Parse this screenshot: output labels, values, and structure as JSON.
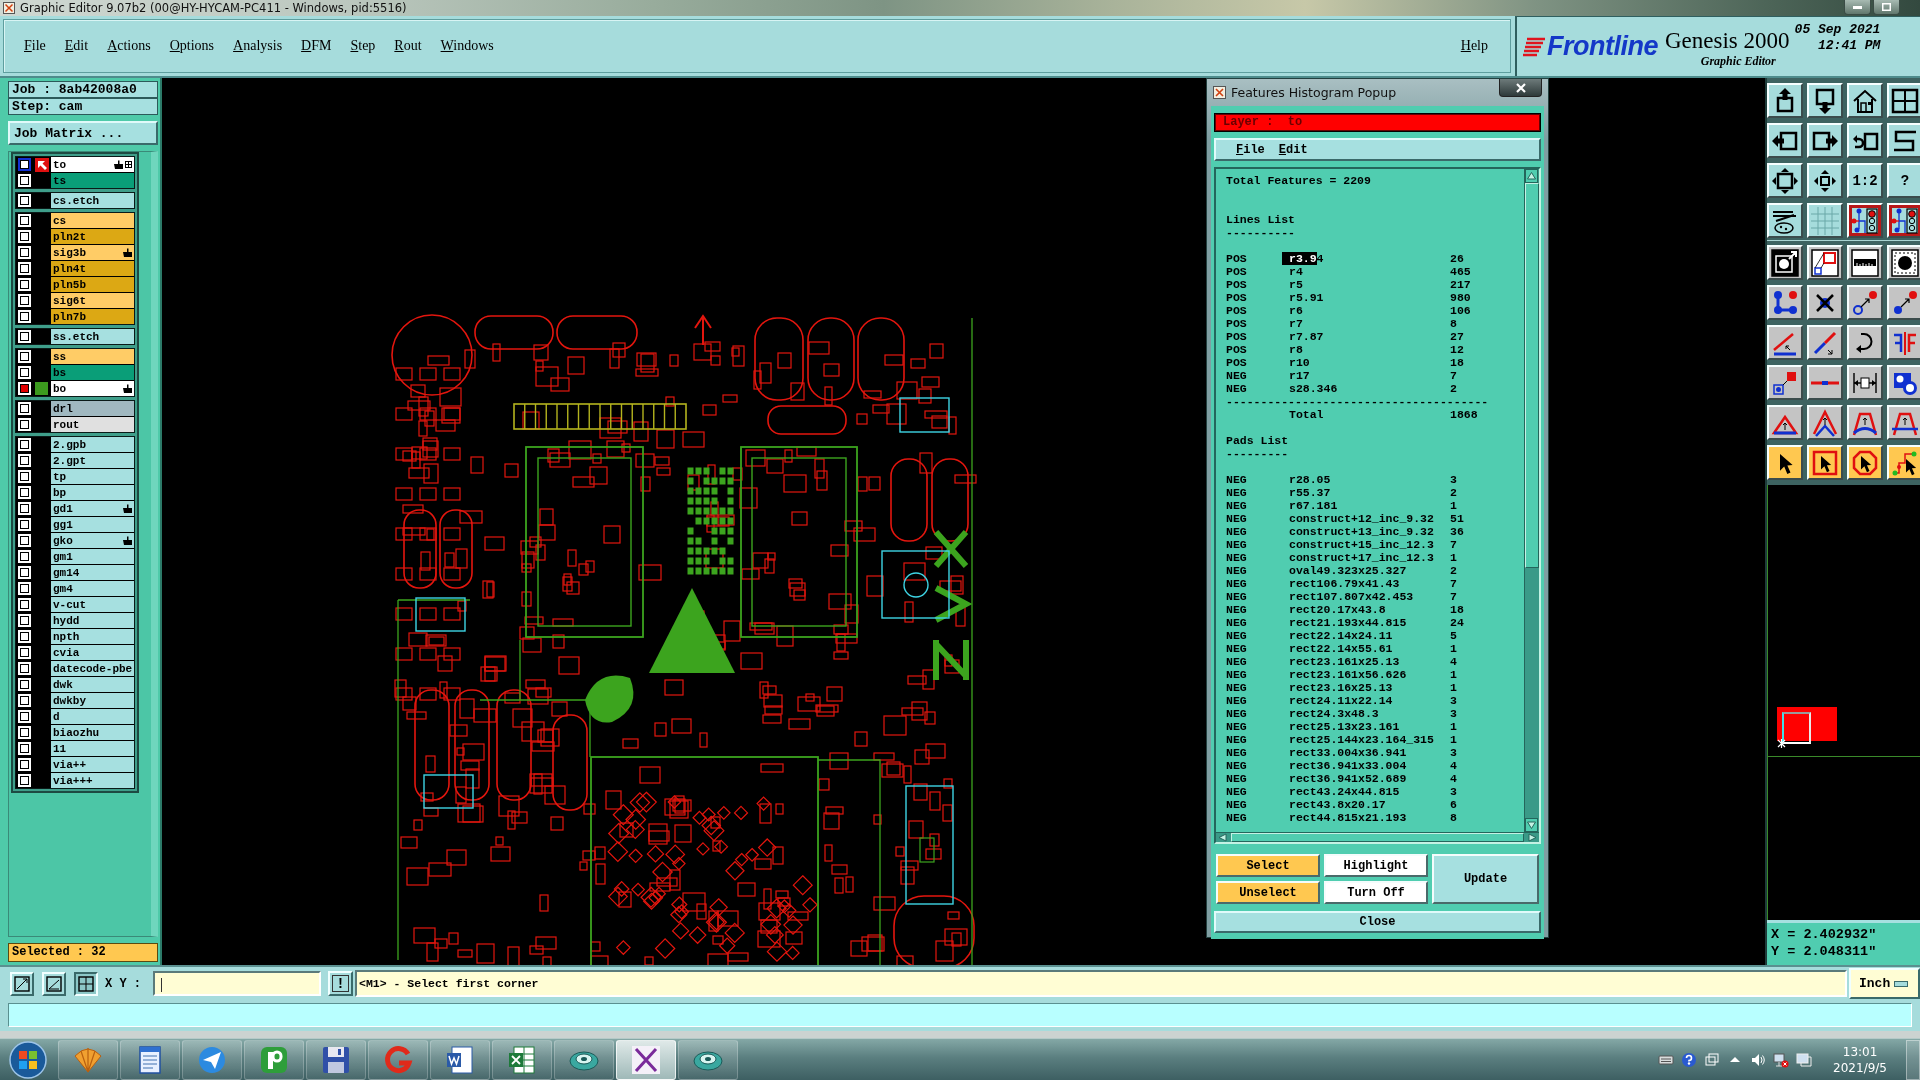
{
  "window": {
    "title": "Graphic Editor 9.07b2 (00@HY-HYCAM-PC411 - Windows, pid:5516)"
  },
  "menu": [
    {
      "label": "File"
    },
    {
      "label": "Edit"
    },
    {
      "label": "Actions"
    },
    {
      "label": "Options"
    },
    {
      "label": "Analysis"
    },
    {
      "label": "DFM"
    },
    {
      "label": "Step"
    },
    {
      "label": "Rout"
    },
    {
      "label": "Windows"
    }
  ],
  "help_menu": {
    "label": "Help"
  },
  "brand": {
    "logo": "Frontline",
    "product": "Genesis 2000",
    "subtitle": "Graphic Editor",
    "date": "05 Sep 2021",
    "time": "12:41 PM"
  },
  "job": {
    "job": "Job : 8ab42008a0",
    "step": "Step: cam",
    "matrix_button": "Job Matrix ..."
  },
  "layer_groups": [
    {
      "layers": [
        {
          "name": "to",
          "color": "#ffffff",
          "work": true,
          "affected": false,
          "displayed": false,
          "flagged": true
        },
        {
          "name": "ts",
          "color": "#0a9e78",
          "work": false,
          "affected": false,
          "displayed": false,
          "flagged": false
        }
      ]
    },
    {
      "layers": [
        {
          "name": "cs.etch",
          "color": "#a6e0e0",
          "work": false,
          "affected": false,
          "displayed": false,
          "flagged": false
        }
      ]
    },
    {
      "layers": [
        {
          "name": "cs",
          "color": "#ffcc66",
          "work": false,
          "affected": false,
          "displayed": false,
          "flagged": false
        },
        {
          "name": "pln2t",
          "color": "#dca814",
          "work": false,
          "affected": false,
          "displayed": false,
          "flagged": false
        },
        {
          "name": "sig3b",
          "color": "#ffcc66",
          "work": false,
          "affected": false,
          "displayed": false,
          "flagged": true
        },
        {
          "name": "pln4t",
          "color": "#dca814",
          "work": false,
          "affected": false,
          "displayed": false,
          "flagged": false
        },
        {
          "name": "pln5b",
          "color": "#dca814",
          "work": false,
          "affected": false,
          "displayed": false,
          "flagged": false
        },
        {
          "name": "sig6t",
          "color": "#ffcc66",
          "work": false,
          "affected": false,
          "displayed": false,
          "flagged": false
        },
        {
          "name": "pln7b",
          "color": "#dca814",
          "work": false,
          "affected": false,
          "displayed": false,
          "flagged": false
        }
      ]
    },
    {
      "layers": [
        {
          "name": "ss.etch",
          "color": "#a6e0e0",
          "work": false,
          "affected": false,
          "displayed": false,
          "flagged": false
        }
      ]
    },
    {
      "layers": [
        {
          "name": "ss",
          "color": "#ffcc66",
          "work": false,
          "affected": false,
          "displayed": false,
          "flagged": false
        },
        {
          "name": "bs",
          "color": "#0a9e78",
          "work": false,
          "affected": false,
          "displayed": false,
          "flagged": false
        },
        {
          "name": "bo",
          "color": "#ffffff",
          "work": false,
          "affected": true,
          "displayed": true,
          "flagged": true
        }
      ]
    },
    {
      "layers": [
        {
          "name": "drl",
          "color": "#a0b8c0",
          "work": false,
          "affected": false,
          "displayed": false,
          "flagged": false
        },
        {
          "name": "rout",
          "color": "#e0e0e0",
          "work": false,
          "affected": false,
          "displayed": false,
          "flagged": false
        }
      ]
    },
    {
      "layers": [
        {
          "name": "2.gpb",
          "color": "#a6e0e0",
          "work": false,
          "affected": false,
          "displayed": false,
          "flagged": false
        },
        {
          "name": "2.gpt",
          "color": "#a6e0e0",
          "work": false,
          "affected": false,
          "displayed": false,
          "flagged": false
        },
        {
          "name": "tp",
          "color": "#a6e0e0",
          "work": false,
          "affected": false,
          "displayed": false,
          "flagged": false
        },
        {
          "name": "bp",
          "color": "#a6e0e0",
          "work": false,
          "affected": false,
          "displayed": false,
          "flagged": false
        },
        {
          "name": "gd1",
          "color": "#a6e0e0",
          "work": false,
          "affected": false,
          "displayed": false,
          "flagged": true
        },
        {
          "name": "gg1",
          "color": "#a6e0e0",
          "work": false,
          "affected": false,
          "displayed": false,
          "flagged": false
        },
        {
          "name": "gko",
          "color": "#a6e0e0",
          "work": false,
          "affected": false,
          "displayed": false,
          "flagged": true
        },
        {
          "name": "gm1",
          "color": "#a6e0e0",
          "work": false,
          "affected": false,
          "displayed": false,
          "flagged": false
        },
        {
          "name": "gm14",
          "color": "#a6e0e0",
          "work": false,
          "affected": false,
          "displayed": false,
          "flagged": false
        },
        {
          "name": "gm4",
          "color": "#a6e0e0",
          "work": false,
          "affected": false,
          "displayed": false,
          "flagged": false
        },
        {
          "name": "v-cut",
          "color": "#a6e0e0",
          "work": false,
          "affected": false,
          "displayed": false,
          "flagged": false
        },
        {
          "name": "hydd",
          "color": "#a6e0e0",
          "work": false,
          "affected": false,
          "displayed": false,
          "flagged": false
        },
        {
          "name": "npth",
          "color": "#a6e0e0",
          "work": false,
          "affected": false,
          "displayed": false,
          "flagged": false
        },
        {
          "name": "cvia",
          "color": "#a6e0e0",
          "work": false,
          "affected": false,
          "displayed": false,
          "flagged": false
        },
        {
          "name": "datecode-pbe",
          "color": "#a6e0e0",
          "work": false,
          "affected": false,
          "displayed": false,
          "flagged": false
        },
        {
          "name": "dwk",
          "color": "#a6e0e0",
          "work": false,
          "affected": false,
          "displayed": false,
          "flagged": false
        },
        {
          "name": "dwkby",
          "color": "#a6e0e0",
          "work": false,
          "affected": false,
          "displayed": false,
          "flagged": false
        },
        {
          "name": "d",
          "color": "#a6e0e0",
          "work": false,
          "affected": false,
          "displayed": false,
          "flagged": false
        },
        {
          "name": "biaozhu",
          "color": "#a6e0e0",
          "work": false,
          "affected": false,
          "displayed": false,
          "flagged": false
        },
        {
          "name": "11",
          "color": "#a6e0e0",
          "work": false,
          "affected": false,
          "displayed": false,
          "flagged": false
        },
        {
          "name": "via++",
          "color": "#a6e0e0",
          "work": false,
          "affected": false,
          "displayed": false,
          "flagged": false
        },
        {
          "name": "via+++",
          "color": "#a6e0e0",
          "work": false,
          "affected": false,
          "displayed": false,
          "flagged": false
        }
      ]
    }
  ],
  "selection": {
    "text": "Selected : 32"
  },
  "histogram": {
    "title": "Features Histogram Popup",
    "layer": "Layer :  to",
    "menu": [
      {
        "label": "File"
      },
      {
        "label": "Edit"
      }
    ],
    "total": "Total Features = 2209",
    "lines_heading": "Lines List",
    "lines_rule": "----------",
    "lines": [
      {
        "polarity": "POS",
        "symbol": [
          {
            "text": "r3.9",
            "selected": true
          },
          {
            "text": "4",
            "selected": false
          }
        ],
        "count": "26"
      },
      {
        "polarity": "POS",
        "symbol": "r4",
        "count": "465"
      },
      {
        "polarity": "POS",
        "symbol": "r5",
        "count": "217"
      },
      {
        "polarity": "POS",
        "symbol": "r5.91",
        "count": "980"
      },
      {
        "polarity": "POS",
        "symbol": "r6",
        "count": "106"
      },
      {
        "polarity": "POS",
        "symbol": "r7",
        "count": "8"
      },
      {
        "polarity": "POS",
        "symbol": "r7.87",
        "count": "27"
      },
      {
        "polarity": "POS",
        "symbol": "r8",
        "count": "12"
      },
      {
        "polarity": "POS",
        "symbol": "r10",
        "count": "18"
      },
      {
        "polarity": "NEG",
        "symbol": "r17",
        "count": "7"
      },
      {
        "polarity": "NEG",
        "symbol": "s28.346",
        "count": "2"
      }
    ],
    "total_rule": "--------------------------------------",
    "total_label": "Total",
    "total_count": "1868",
    "pads_heading": "Pads List",
    "pads_rule": "---------",
    "pads": [
      {
        "polarity": "NEG",
        "symbol": "r28.05",
        "count": "3"
      },
      {
        "polarity": "NEG",
        "symbol": "r55.37",
        "count": "2"
      },
      {
        "polarity": "NEG",
        "symbol": "r67.181",
        "count": "1"
      },
      {
        "polarity": "NEG",
        "symbol": "construct+12_inc_9.32",
        "count": "51"
      },
      {
        "polarity": "NEG",
        "symbol": "construct+13_inc_9.32",
        "count": "36"
      },
      {
        "polarity": "NEG",
        "symbol": "construct+15_inc_12.3",
        "count": "7"
      },
      {
        "polarity": "NEG",
        "symbol": "construct+17_inc_12.3",
        "count": "1"
      },
      {
        "polarity": "NEG",
        "symbol": "oval49.323x25.327",
        "count": "2"
      },
      {
        "polarity": "NEG",
        "symbol": "rect106.79x41.43",
        "count": "7"
      },
      {
        "polarity": "NEG",
        "symbol": "rect107.807x42.453",
        "count": "7"
      },
      {
        "polarity": "NEG",
        "symbol": "rect20.17x43.8",
        "count": "18"
      },
      {
        "polarity": "NEG",
        "symbol": "rect21.193x44.815",
        "count": "24"
      },
      {
        "polarity": "NEG",
        "symbol": "rect22.14x24.11",
        "count": "5"
      },
      {
        "polarity": "NEG",
        "symbol": "rect22.14x55.61",
        "count": "1"
      },
      {
        "polarity": "NEG",
        "symbol": "rect23.161x25.13",
        "count": "4"
      },
      {
        "polarity": "NEG",
        "symbol": "rect23.161x56.626",
        "count": "1"
      },
      {
        "polarity": "NEG",
        "symbol": "rect23.16x25.13",
        "count": "1"
      },
      {
        "polarity": "NEG",
        "symbol": "rect24.11x22.14",
        "count": "3"
      },
      {
        "polarity": "NEG",
        "symbol": "rect24.3x48.3",
        "count": "3"
      },
      {
        "polarity": "NEG",
        "symbol": "rect25.13x23.161",
        "count": "1"
      },
      {
        "polarity": "NEG",
        "symbol": "rect25.144x23.164_315",
        "count": "1"
      },
      {
        "polarity": "NEG",
        "symbol": "rect33.004x36.941",
        "count": "3"
      },
      {
        "polarity": "NEG",
        "symbol": "rect36.941x33.004",
        "count": "4"
      },
      {
        "polarity": "NEG",
        "symbol": "rect36.941x52.689",
        "count": "4"
      },
      {
        "polarity": "NEG",
        "symbol": "rect43.24x44.815",
        "count": "3"
      },
      {
        "polarity": "NEG",
        "symbol": "rect43.8x20.17",
        "count": "6"
      },
      {
        "polarity": "NEG",
        "symbol": "rect44.815x21.193",
        "count": "8"
      }
    ],
    "buttons": [
      {
        "label": "Select",
        "color": "#ffc850"
      },
      {
        "label": "Highlight",
        "color": "#ffffff"
      },
      {
        "label": "Update",
        "color": "#a6e0e0"
      },
      {
        "label": "Unselect",
        "color": "#ffc850"
      },
      {
        "label": "Turn Off",
        "color": "#ffffff"
      }
    ],
    "close_button": "Close"
  },
  "toolbar": [
    {
      "kind": "view",
      "buttons": [
        {
          "on": false
        },
        {
          "on": false
        },
        {
          "on": false
        },
        {
          "on": false
        }
      ]
    },
    {
      "kind": "view",
      "buttons": [
        {
          "on": false
        },
        {
          "on": false
        },
        {
          "on": false
        },
        {
          "on": false
        }
      ]
    },
    {
      "kind": "view",
      "buttons": [
        {
          "on": false
        },
        {
          "on": false
        },
        {
          "on": false,
          "label": "1:2"
        },
        {
          "on": false,
          "label": "?"
        }
      ]
    },
    {
      "kind": "view",
      "buttons": [
        {
          "on": false
        },
        {
          "on": false
        },
        {
          "on": true
        },
        {
          "on": true
        }
      ]
    },
    {
      "kind": "measure",
      "buttons": [
        {
          "on": false
        },
        {
          "on": false
        },
        {
          "on": false
        },
        {
          "on": false
        }
      ]
    },
    {
      "kind": "edit",
      "buttons": [
        {
          "on": false
        },
        {
          "on": false
        },
        {
          "on": false
        },
        {
          "on": false
        }
      ]
    },
    {
      "kind": "edit",
      "buttons": [
        {
          "on": false
        },
        {
          "on": false
        },
        {
          "on": false
        },
        {
          "on": false
        }
      ]
    },
    {
      "kind": "edit",
      "buttons": [
        {
          "on": false
        },
        {
          "on": false
        },
        {
          "on": false
        },
        {
          "on": false
        }
      ]
    },
    {
      "kind": "edit",
      "buttons": [
        {
          "on": false
        },
        {
          "on": false
        },
        {
          "on": false
        },
        {
          "on": false
        }
      ]
    },
    {
      "kind": "select",
      "buttons": [
        {
          "on": false
        },
        {
          "on": false
        },
        {
          "on": false
        },
        {
          "on": false
        }
      ]
    }
  ],
  "coordinates": {
    "x": "X = 2.402932\"",
    "y": "Y = 2.048311\""
  },
  "command_bar": {
    "label": "X Y :",
    "alert_button": "!",
    "message": "<M1> - Select first corner",
    "units": "Inch"
  },
  "taskbar": {
    "apps": [
      {
        "selected": false
      },
      {
        "selected": false
      },
      {
        "selected": false
      },
      {
        "selected": false
      },
      {
        "selected": false
      },
      {
        "selected": false
      },
      {
        "selected": false
      },
      {
        "selected": false
      },
      {
        "selected": false
      },
      {
        "selected": true
      },
      {
        "selected": false
      }
    ],
    "time": "13:01",
    "date": "2021/9/5"
  }
}
